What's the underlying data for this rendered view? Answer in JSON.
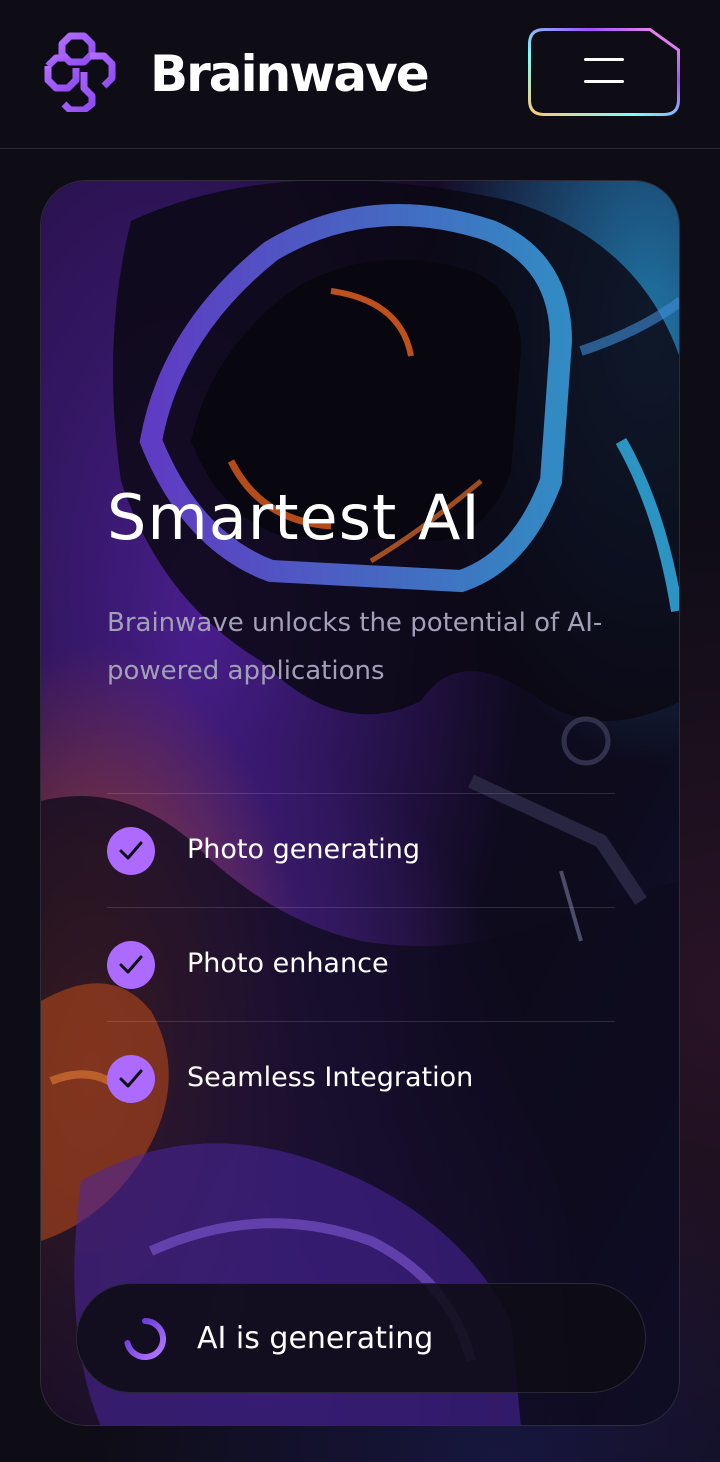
{
  "header": {
    "brand_name": "Brainwave",
    "logo_icon": "brainwave-logo-icon",
    "menu_icon": "hamburger-menu-icon"
  },
  "hero": {
    "title": "Smartest AI",
    "description": "Brainwave unlocks the potential of AI-powered applications",
    "features": [
      {
        "label": "Photo generating",
        "icon": "check-icon"
      },
      {
        "label": "Photo enhance",
        "icon": "check-icon"
      },
      {
        "label": "Seamless Integration",
        "icon": "check-icon"
      }
    ],
    "status": {
      "label": "AI is generating",
      "icon": "loading-spinner-icon"
    }
  },
  "colors": {
    "background": "#0e0c15",
    "accent_purple": "#ac6aff",
    "text_muted": "#a49fb8",
    "border": "#2a2835"
  }
}
